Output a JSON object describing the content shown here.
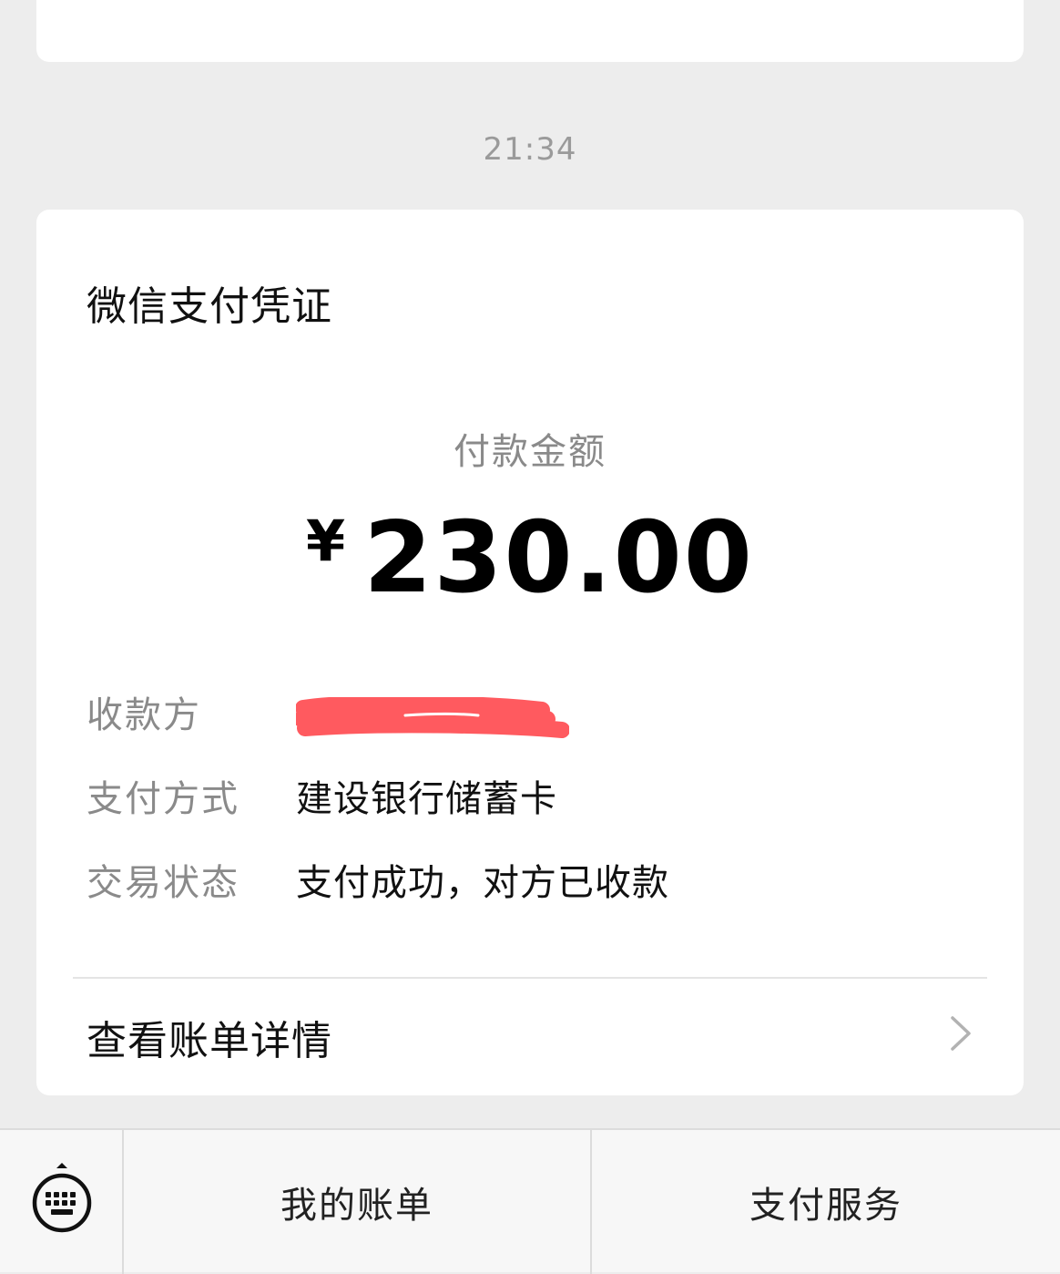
{
  "timestamp": "21:34",
  "card": {
    "title": "微信支付凭证",
    "amount_label": "付款金额",
    "currency_symbol": "¥",
    "amount": "230.00",
    "fields": [
      {
        "label": "收款方",
        "value": ""
      },
      {
        "label": "支付方式",
        "value": "建设银行储蓄卡"
      },
      {
        "label": "交易状态",
        "value": "支付成功，对方已收款"
      }
    ],
    "detail_link": "查看账单详情"
  },
  "bottom_bar": {
    "menu_items": [
      "我的账单",
      "支付服务"
    ]
  },
  "colors": {
    "background": "#ededed",
    "card": "#ffffff",
    "redaction": "#ff5a5f"
  },
  "icons": {
    "redaction": "redaction-scribble",
    "chevron": "chevron-right-icon",
    "keyboard": "keyboard-icon"
  }
}
